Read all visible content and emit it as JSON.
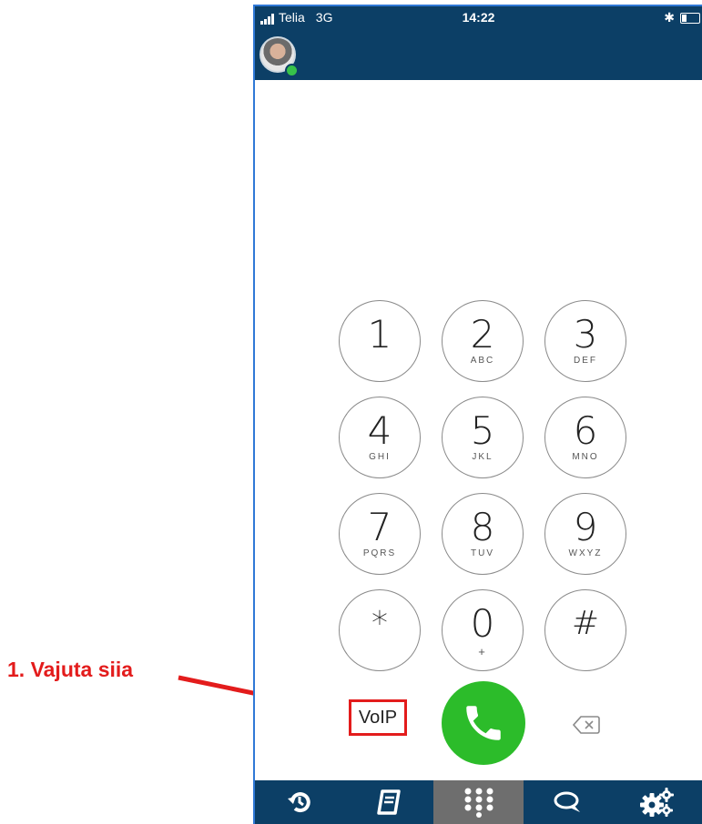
{
  "status": {
    "carrier": "Telia",
    "network": "3G",
    "time": "14:22",
    "bluetooth": "✱"
  },
  "keypad": [
    {
      "digit": "1",
      "letters": ""
    },
    {
      "digit": "2",
      "letters": "ABC"
    },
    {
      "digit": "3",
      "letters": "DEF"
    },
    {
      "digit": "4",
      "letters": "GHI"
    },
    {
      "digit": "5",
      "letters": "JKL"
    },
    {
      "digit": "6",
      "letters": "MNO"
    },
    {
      "digit": "7",
      "letters": "PQRS"
    },
    {
      "digit": "8",
      "letters": "TUV"
    },
    {
      "digit": "9",
      "letters": "WXYZ"
    },
    {
      "digit": "*",
      "letters": ""
    },
    {
      "digit": "0",
      "letters": "+"
    },
    {
      "digit": "#",
      "letters": ""
    }
  ],
  "controls": {
    "voip_label": "VoIP"
  },
  "tabs": [
    {
      "icon": "history-icon"
    },
    {
      "icon": "contacts-book-icon"
    },
    {
      "icon": "dialpad-icon",
      "active": true
    },
    {
      "icon": "chat-icon"
    },
    {
      "icon": "settings-icon"
    }
  ],
  "annotation": {
    "text": "1. Vajuta siia"
  },
  "colors": {
    "header": "#0c3f66",
    "call": "#2cbc2a",
    "annotation": "#e31c1c",
    "frame": "#2f78d6"
  }
}
